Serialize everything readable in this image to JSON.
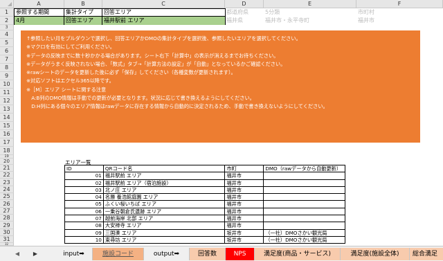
{
  "columns": [
    "A",
    "B",
    "C",
    "D",
    "E",
    "F"
  ],
  "rows": [
    "1",
    "2",
    "3",
    "4",
    "5",
    "6",
    "7",
    "8",
    "9",
    "10",
    "11",
    "12",
    "13",
    "14",
    "15",
    "16",
    "17",
    "18",
    "19",
    "20",
    "21",
    "22",
    "23",
    "24",
    "25",
    "26",
    "27",
    "28",
    "29",
    "30",
    "31",
    "32"
  ],
  "header_cells": {
    "a1": "参照する期間",
    "b1": "集計タイプ",
    "c1": "回答エリア",
    "d1": "都道府県",
    "e1": "5分類",
    "f1": "市町村",
    "a2": "4月",
    "b2": "回答エリア",
    "c2": "福井駅前 エリア",
    "d2": "福井県",
    "e2": "福井市・永平寺町",
    "f2": "福井市"
  },
  "notes": [
    "↑参照したい月をプルダウンで選択し、回答エリアかDMOの集計タイプを選択後、参照したいエリアを選択してください。",
    "※マクロを有効にしてご利用ください。",
    "※データの反映までに数十秒かかる場合があります。シート右下「計算中」の表示が消えるまでお待ちください。",
    "※データがうまく反映されない場合、「数式」タブ→「計算方法の設定」が「自動」となっているかご確認ください。",
    "※rawシートのデータを更新した後に必ず「保存」してください（各種変数が更新されます）。",
    "※対応ソフトはエクセル365以降です。",
    "※［M］エリア シートに関する注意",
    "　A:B列のDMO情報は手動での更新が必要となります。状況に応じて書き換えるようにしてください。",
    "　D:H列にある個々のエリア情報はrawデータに存在する情報から自動的に決定されるため、手動で書き換えないようにしてください。"
  ],
  "area_table": {
    "title": "エリア一覧",
    "headers": [
      "ID",
      "QRコード名",
      "市町",
      "DMO（rawデータから自動更新）"
    ],
    "rows": [
      [
        "01",
        "福井駅前 エリア",
        "福井市",
        ""
      ],
      [
        "02",
        "福井駅前 エリア（宿泊施設）",
        "福井市",
        ""
      ],
      [
        "03",
        "北ノ庄 エリア",
        "福井市",
        ""
      ],
      [
        "04",
        "名勝 養浩館庭園 エリア",
        "福井市",
        ""
      ],
      [
        "05",
        "ふくい桜いちば エリア",
        "福井市",
        ""
      ],
      [
        "06",
        "一乗谷朝倉氏遺跡 エリア",
        "福井市",
        ""
      ],
      [
        "07",
        "越前海岸 北部 エリア",
        "福井市",
        ""
      ],
      [
        "08",
        "大安禅寺 エリア",
        "福井市",
        ""
      ],
      [
        "09",
        "三国湊 エリア",
        "坂井市",
        "（一社）DMOさかい観光局"
      ],
      [
        "10",
        "東尋坊 エリア",
        "坂井市",
        "（一社）DMOさかい観光局"
      ]
    ]
  },
  "sheet_tabs": [
    "input➡",
    "施設コード",
    "output➡",
    "回答数",
    "NPS",
    "満足度(商品・サービス)",
    "満足度(施設全体)",
    "総合満足"
  ],
  "nav": {
    "prev": "◀",
    "next": "▶",
    "more": "..."
  },
  "colors": {
    "orange_panel": "#ed7d31",
    "green_cell": "#a9d08e",
    "nps_tab": "#ff0000",
    "facility_tab": "#f4b183",
    "orange_tab": "#f8cbad"
  }
}
